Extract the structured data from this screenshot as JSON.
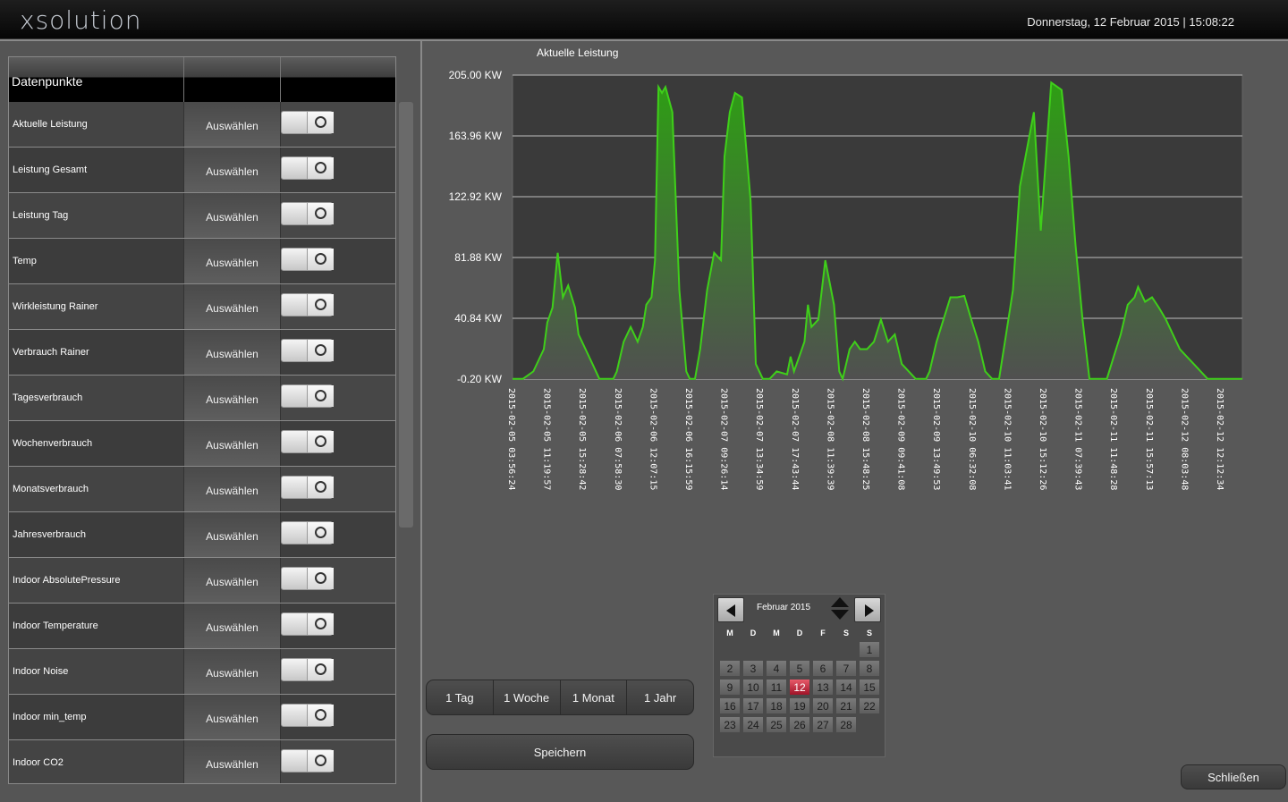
{
  "app": {
    "logo": "xsolution",
    "datetime": "Donnerstag, 12 Februar 2015  |  15:08:22"
  },
  "datapoints": {
    "header": "Datenpunkte",
    "select_label": "Auswählen",
    "items": [
      {
        "label": "Aktuelle Leistung"
      },
      {
        "label": "Leistung Gesamt"
      },
      {
        "label": "Leistung Tag"
      },
      {
        "label": "Temp"
      },
      {
        "label": "Wirkleistung Rainer"
      },
      {
        "label": "Verbrauch Rainer"
      },
      {
        "label": "Tagesverbrauch"
      },
      {
        "label": "Wochenverbrauch"
      },
      {
        "label": "Monatsverbrauch"
      },
      {
        "label": "Jahresverbrauch"
      },
      {
        "label": "Indoor  AbsolutePressure"
      },
      {
        "label": "Indoor  Temperature"
      },
      {
        "label": "Indoor  Noise"
      },
      {
        "label": "Indoor  min_temp"
      },
      {
        "label": "Indoor  CO2"
      }
    ]
  },
  "range_buttons": [
    "1 Tag",
    "1 Woche",
    "1 Monat",
    "1 Jahr"
  ],
  "save_label": "Speichern",
  "close_label": "Schließen",
  "calendar": {
    "month_label": "Februar 2015",
    "weekdays": [
      "M",
      "D",
      "M",
      "D",
      "F",
      "S",
      "S"
    ],
    "days": [
      "1",
      "2",
      "3",
      "4",
      "5",
      "6",
      "7",
      "8",
      "9",
      "10",
      "11",
      "12",
      "13",
      "14",
      "15",
      "16",
      "17",
      "18",
      "19",
      "20",
      "21",
      "22",
      "23",
      "24",
      "25",
      "26",
      "27",
      "28"
    ],
    "first_weekday_index": 6,
    "today": "12"
  },
  "colors": {
    "line": "#3fcf1a",
    "fill_top": "#2e9e14",
    "fill_bottom": "#505050",
    "plot_bg": "#3c3c3c",
    "today": "#c21a30"
  },
  "chart_data": {
    "type": "area",
    "title": "Aktuelle Leistung",
    "ylabel": "",
    "y_unit": "KW",
    "ylim": [
      -0.2,
      205.0
    ],
    "y_ticks": [
      "205.00 KW",
      "163.96 KW",
      "122.92 KW",
      "81.88 KW",
      "40.84 KW",
      "-0.20 KW"
    ],
    "y_tick_values": [
      205.0,
      163.96,
      122.92,
      81.88,
      40.84,
      -0.2
    ],
    "x_tick_labels": [
      "2015-02-05 03:56:24",
      "2015-02-05 11:19:57",
      "2015-02-05 15:28:42",
      "2015-02-06 07:58:30",
      "2015-02-06 12:07:15",
      "2015-02-06 16:15:59",
      "2015-02-07 09:26:14",
      "2015-02-07 13:34:59",
      "2015-02-07 17:43:44",
      "2015-02-08 11:39:39",
      "2015-02-08 15:48:25",
      "2015-02-09 09:41:08",
      "2015-02-09 13:49:53",
      "2015-02-10 06:32:08",
      "2015-02-10 11:03:41",
      "2015-02-10 15:12:26",
      "2015-02-11 07:39:43",
      "2015-02-11 11:48:28",
      "2015-02-11 15:57:13",
      "2015-02-12 08:03:48",
      "2015-02-12 12:12:34"
    ],
    "x": [
      0,
      0.3,
      0.6,
      0.9,
      1.0,
      1.15,
      1.3,
      1.45,
      1.6,
      1.8,
      1.9,
      2.1,
      2.3,
      2.5,
      2.7,
      2.9,
      3.0,
      3.2,
      3.4,
      3.6,
      3.75,
      3.85,
      4.0,
      4.1,
      4.2,
      4.3,
      4.4,
      4.6,
      4.8,
      5.0,
      5.1,
      5.25,
      5.4,
      5.6,
      5.8,
      6.0,
      6.1,
      6.25,
      6.4,
      6.6,
      6.85,
      7.0,
      7.2,
      7.4,
      7.6,
      7.9,
      8.0,
      8.1,
      8.25,
      8.4,
      8.5,
      8.6,
      8.8,
      9.0,
      9.25,
      9.4,
      9.5,
      9.7,
      9.85,
      10.0,
      10.2,
      10.4,
      10.6,
      10.8,
      11.0,
      11.2,
      11.4,
      11.6,
      11.75,
      11.9,
      12.0,
      12.2,
      12.4,
      12.6,
      12.8,
      13.0,
      13.2,
      13.4,
      13.6,
      13.8,
      14.0,
      14.2,
      14.4,
      14.6,
      14.8,
      15.0,
      15.2,
      15.5,
      15.8,
      16.0,
      16.2,
      16.4,
      16.6,
      16.75,
      16.9,
      17.0,
      17.1,
      17.3,
      17.5,
      17.7,
      17.9,
      18.0,
      18.2,
      18.4,
      18.6,
      18.8,
      19.0,
      19.2,
      19.4,
      19.6,
      19.8,
      20.0,
      20.2,
      20.4,
      20.6,
      20.8,
      21.0
    ],
    "values": [
      0,
      0,
      5,
      20,
      38,
      48,
      85,
      55,
      63,
      48,
      30,
      20,
      10,
      0,
      0,
      0,
      5,
      25,
      35,
      25,
      35,
      50,
      55,
      80,
      197,
      193,
      197,
      180,
      60,
      5,
      0,
      0,
      20,
      60,
      85,
      80,
      150,
      180,
      193,
      190,
      120,
      10,
      0,
      0,
      5,
      3,
      15,
      5,
      15,
      25,
      50,
      35,
      40,
      80,
      50,
      5,
      0,
      20,
      25,
      20,
      20,
      25,
      40,
      25,
      30,
      10,
      5,
      0,
      0,
      0,
      5,
      25,
      40,
      55,
      55,
      56,
      40,
      25,
      5,
      0,
      0,
      30,
      60,
      130,
      155,
      180,
      100,
      200,
      195,
      150,
      90,
      40,
      0,
      0,
      0,
      0,
      0,
      15,
      30,
      50,
      55,
      62,
      52,
      55,
      48,
      40,
      30,
      20,
      15,
      10,
      5,
      0,
      0,
      0,
      0,
      0,
      0
    ]
  }
}
